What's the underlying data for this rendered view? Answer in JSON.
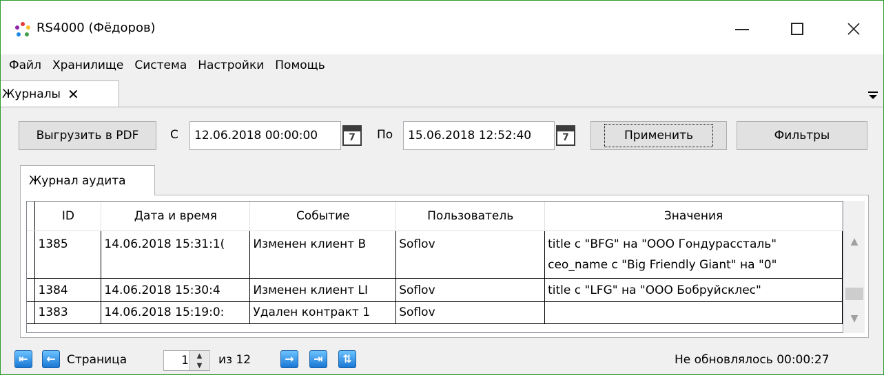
{
  "window": {
    "title": "RS4000 (Фёдоров)",
    "border_color": "#2c9b2c"
  },
  "menu": [
    "Файл",
    "Хранилище",
    "Система",
    "Настройки",
    "Помощь"
  ],
  "doc_tab": {
    "label": "Журналы",
    "close": "✕"
  },
  "toolbar": {
    "export_pdf": "Выгрузить в PDF",
    "from_label": "С",
    "from_value": "12.06.2018 00:00:00",
    "to_label": "По",
    "to_value": "15.06.2018 12:52:40",
    "apply": "Применить",
    "filters": "Фильтры",
    "calendar_day": "7"
  },
  "inner_tab": "Журнал аудита",
  "table": {
    "columns": [
      "ID",
      "Дата и время",
      "Событие",
      "Пользователь",
      "Значения"
    ],
    "rows": [
      {
        "id": "1385",
        "datetime": "14.06.2018 15:31:1(",
        "event": "Изменен клиент В",
        "user": "Soflov",
        "values": [
          "title с \"BFG\" на \"ООО Гондурассталь\"",
          "ceo_name с \"Big Friendly Giant\" на \"0\""
        ]
      },
      {
        "id": "1384",
        "datetime": "14.06.2018 15:30:4",
        "event": "Изменен клиент LI",
        "user": "Soflov",
        "values": [
          "title с \"LFG\" на \"ООО Бобруйсклес\""
        ]
      },
      {
        "id": "1383",
        "datetime": "14.06.2018 15:19:0:",
        "event": "Удален контракт 1",
        "user": "Soflov",
        "values": [
          ""
        ]
      }
    ]
  },
  "pager": {
    "page_label": "Страница",
    "page_value": "1",
    "of_label": "из 12",
    "status": "Не обновлялось 00:00:27"
  },
  "icons": {
    "app": "rs4000-app-icon",
    "calendar": "calendar-icon",
    "first": "first-page-icon",
    "prev": "prev-page-icon",
    "next": "next-page-icon",
    "last": "last-page-icon",
    "refresh": "refresh-icon"
  }
}
